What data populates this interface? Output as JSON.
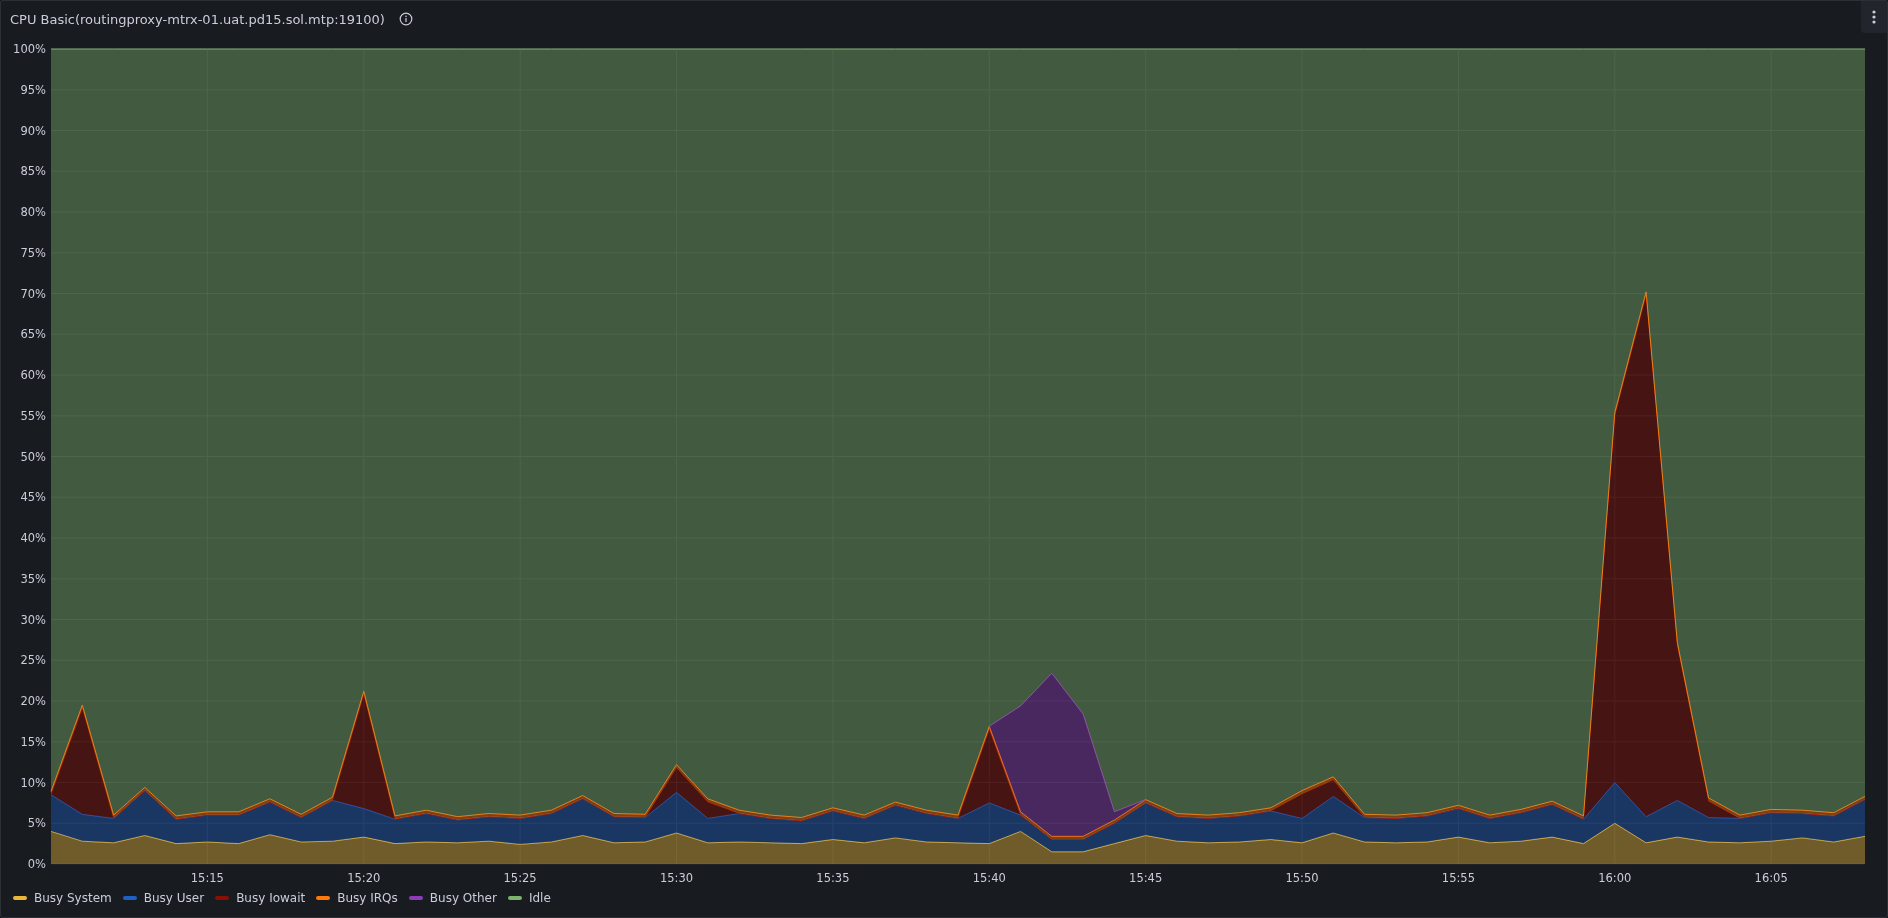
{
  "panel": {
    "title": "CPU Basic(routingproxy-mtrx-01.uat.pd15.sol.mtp:19100)",
    "chart_data": {
      "type": "area",
      "stacked": true,
      "categories": [
        null,
        null,
        null,
        null,
        null,
        "15:15",
        null,
        null,
        null,
        null,
        "15:20",
        null,
        null,
        null,
        null,
        "15:25",
        null,
        null,
        null,
        null,
        "15:30",
        null,
        null,
        null,
        null,
        "15:35",
        null,
        null,
        null,
        null,
        "15:40",
        null,
        null,
        null,
        null,
        "15:45",
        null,
        null,
        null,
        null,
        "15:50",
        null,
        null,
        null,
        null,
        "15:55",
        null,
        null,
        null,
        null,
        "16:00",
        null,
        null,
        null,
        null,
        "16:05",
        null,
        null,
        null
      ],
      "ylim": [
        0,
        100
      ],
      "grid": true,
      "yticks": [
        {
          "value": 0,
          "label": "0%"
        },
        {
          "value": 5,
          "label": "5%"
        },
        {
          "value": 10,
          "label": "10%"
        },
        {
          "value": 15,
          "label": "15%"
        },
        {
          "value": 20,
          "label": "20%"
        },
        {
          "value": 25,
          "label": "25%"
        },
        {
          "value": 30,
          "label": "30%"
        },
        {
          "value": 35,
          "label": "35%"
        },
        {
          "value": 40,
          "label": "40%"
        },
        {
          "value": 45,
          "label": "45%"
        },
        {
          "value": 50,
          "label": "50%"
        },
        {
          "value": 55,
          "label": "55%"
        },
        {
          "value": 60,
          "label": "60%"
        },
        {
          "value": 65,
          "label": "65%"
        },
        {
          "value": 70,
          "label": "70%"
        },
        {
          "value": 75,
          "label": "75%"
        },
        {
          "value": 80,
          "label": "80%"
        },
        {
          "value": 85,
          "label": "85%"
        },
        {
          "value": 90,
          "label": "90%"
        },
        {
          "value": 95,
          "label": "95%"
        },
        {
          "value": 100,
          "label": "100%"
        }
      ],
      "series": [
        {
          "name": "Busy System",
          "color": "#eab839",
          "values": [
            4,
            2.8,
            2.6,
            3.5,
            2.5,
            2.7,
            2.5,
            3.6,
            2.7,
            2.8,
            3.3,
            2.5,
            2.7,
            2.6,
            2.8,
            2.4,
            2.7,
            3.5,
            2.6,
            2.7,
            3.8,
            2.6,
            2.7,
            2.6,
            2.5,
            3,
            2.6,
            3.2,
            2.7,
            2.6,
            2.5,
            4,
            1.5,
            1.5,
            2.5,
            3.5,
            2.8,
            2.6,
            2.7,
            3,
            2.6,
            3.8,
            2.7,
            2.6,
            2.7,
            3.3,
            2.6,
            2.8,
            3.3,
            2.5,
            5,
            2.6,
            3.3,
            2.7,
            2.6,
            2.8,
            3.2,
            2.7,
            3.4
          ]
        },
        {
          "name": "Busy User",
          "color": "#1f60c4",
          "values": [
            4.5,
            3.3,
            3,
            5.5,
            3,
            3.3,
            3.5,
            4,
            3,
            5,
            3.5,
            3,
            3.5,
            2.8,
            3,
            3.2,
            3.5,
            4.5,
            3.2,
            3,
            5,
            3,
            3.5,
            3,
            2.8,
            3.5,
            3,
            4,
            3.5,
            3,
            5,
            2,
            1.5,
            1.5,
            2.5,
            4,
            3,
            3,
            3.2,
            3.5,
            3,
            4.5,
            3,
            3,
            3.2,
            3.5,
            3,
            3.5,
            4,
            3,
            5,
            3.2,
            4.5,
            3,
            3,
            3.5,
            3,
            3.2,
            4.5
          ]
        },
        {
          "name": "Busy Iowait",
          "color": "#890f02",
          "values": [
            0,
            13,
            0,
            0,
            0,
            0,
            0,
            0,
            0,
            0,
            14,
            0,
            0,
            0,
            0,
            0,
            0,
            0,
            0,
            0,
            3,
            2,
            0,
            0,
            0,
            0,
            0,
            0,
            0,
            0,
            9,
            0,
            0,
            0,
            0,
            0,
            0,
            0,
            0,
            0,
            3,
            2,
            0,
            0,
            0,
            0,
            0,
            0,
            0,
            0,
            45,
            64,
            19,
            2,
            0,
            0,
            0,
            0,
            0
          ]
        },
        {
          "name": "Busy IRQs",
          "color": "#ff780a",
          "values": [
            0.4,
            0.4,
            0.4,
            0.4,
            0.4,
            0.4,
            0.4,
            0.4,
            0.4,
            0.4,
            0.4,
            0.4,
            0.4,
            0.4,
            0.4,
            0.4,
            0.4,
            0.4,
            0.4,
            0.4,
            0.4,
            0.4,
            0.4,
            0.4,
            0.4,
            0.4,
            0.4,
            0.4,
            0.4,
            0.4,
            0.4,
            0.4,
            0.4,
            0.4,
            0.4,
            0.4,
            0.4,
            0.4,
            0.4,
            0.4,
            0.4,
            0.4,
            0.4,
            0.4,
            0.4,
            0.4,
            0.4,
            0.4,
            0.4,
            0.4,
            0.4,
            0.4,
            0.4,
            0.4,
            0.4,
            0.4,
            0.4,
            0.4,
            0.4
          ]
        },
        {
          "name": "Busy Other",
          "color": "#8f3bb8",
          "values": [
            null,
            null,
            null,
            null,
            null,
            null,
            null,
            null,
            null,
            null,
            null,
            null,
            null,
            null,
            null,
            null,
            null,
            null,
            null,
            null,
            null,
            null,
            null,
            null,
            null,
            null,
            null,
            null,
            null,
            null,
            0,
            13,
            20,
            15,
            1,
            0,
            null,
            null,
            null,
            null,
            null,
            null,
            null,
            null,
            null,
            null,
            null,
            null,
            null,
            null,
            null,
            null,
            null,
            null,
            null,
            null,
            null,
            null,
            null
          ]
        },
        {
          "name": "Idle",
          "color": "#7eb26d",
          "values": [
            91.1,
            80.5,
            94,
            90.6,
            94.1,
            93.6,
            93.6,
            92,
            93.9,
            91.8,
            78.8,
            94.1,
            93.4,
            94.2,
            93.8,
            94,
            93.4,
            91.6,
            93.8,
            93.9,
            87.8,
            92,
            93.4,
            94,
            94.3,
            93.1,
            94,
            92.4,
            93.4,
            94,
            83.1,
            80.6,
            76.6,
            81.6,
            93.6,
            92.1,
            93.8,
            94,
            93.7,
            93.1,
            91,
            89.3,
            93.9,
            94,
            93.7,
            92.8,
            94,
            93.3,
            92.3,
            94.1,
            44.6,
            29.8,
            72.8,
            91.9,
            94,
            93.3,
            93.4,
            93.7,
            91.7
          ]
        }
      ]
    }
  }
}
